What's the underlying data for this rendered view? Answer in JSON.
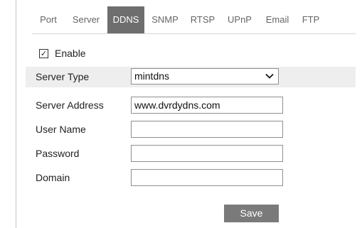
{
  "tabs": [
    {
      "label": "Port",
      "active": false
    },
    {
      "label": "Server",
      "active": false
    },
    {
      "label": "DDNS",
      "active": true
    },
    {
      "label": "SNMP",
      "active": false
    },
    {
      "label": "RTSP",
      "active": false
    },
    {
      "label": "UPnP",
      "active": false
    },
    {
      "label": "Email",
      "active": false
    },
    {
      "label": "FTP",
      "active": false
    }
  ],
  "enable": {
    "label": "Enable",
    "checked": true,
    "mark": "✓"
  },
  "form": {
    "server_type": {
      "label": "Server Type",
      "value": "mintdns"
    },
    "server_address": {
      "label": "Server Address",
      "value": "www.dvrdydns.com"
    },
    "user_name": {
      "label": "User Name",
      "value": ""
    },
    "password": {
      "label": "Password",
      "value": ""
    },
    "domain": {
      "label": "Domain",
      "value": ""
    }
  },
  "actions": {
    "save_label": "Save"
  },
  "colors": {
    "active_tab": "#6e6e6e",
    "save_button": "#7a7a7a",
    "shaded_row": "#eeeeee"
  }
}
